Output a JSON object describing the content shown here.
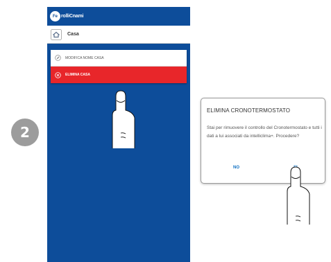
{
  "step": {
    "number": "2"
  },
  "app": {
    "logo_letters": "Fe",
    "logo_text": "rolliCnami",
    "title": "Casa"
  },
  "menu": {
    "rename_label": "MODIFICA NOME CASA",
    "delete_label": "ELIMINA CASA"
  },
  "dialog": {
    "title": "ELIMINA CRONOTERMOSTATO",
    "message": "Stai per rimuovere il controllo del Cronotermostato e tutti i dati a lui associati da intelliclima+. Procedere?",
    "no_label": "NO",
    "yes_label": "SI"
  },
  "icons": {
    "house": "house-icon",
    "edit": "edit-icon",
    "delete": "close-circle-icon",
    "pointer": "pointing-hand-icon"
  },
  "colors": {
    "app_blue": "#0d4d9a",
    "delete_red": "#e8262a",
    "badge_gray": "#9c9c9c",
    "dialog_button": "#0d6fc2"
  }
}
